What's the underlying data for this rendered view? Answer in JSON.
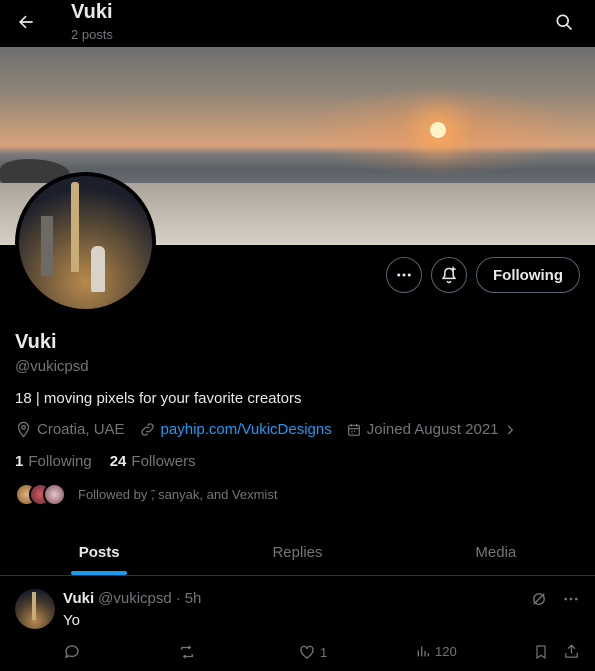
{
  "header": {
    "title": "Vuki",
    "subtitle": "2 posts"
  },
  "profile": {
    "name": "Vuki",
    "handle": "@vukicpsd",
    "bio": "18 | moving pixels for your favorite creators",
    "location": "Croatia, UAE",
    "website": "payhip.com/VukicDesigns",
    "joined": "Joined August 2021",
    "following_count": "1",
    "following_label": "Following",
    "followers_count": "24",
    "followers_label": "Followers",
    "followed_by": "Followed by ̃, sanyak, and Vexmist",
    "follow_button_label": "Following"
  },
  "tabs": [
    {
      "label": "Posts",
      "active": true
    },
    {
      "label": "Replies",
      "active": false
    },
    {
      "label": "Media",
      "active": false
    }
  ],
  "post": {
    "author": "Vuki",
    "handle": "@vukicpsd",
    "separator": "·",
    "time": "5h",
    "text": "Yo",
    "likes": "1",
    "views": "120"
  },
  "colors": {
    "accent": "#1d9bf0",
    "background": "#000000",
    "muted": "#71767b",
    "border": "#2f3336"
  },
  "icons": [
    "back-arrow-icon",
    "search-icon",
    "more-icon",
    "notification-add-icon",
    "location-icon",
    "link-icon",
    "calendar-icon",
    "chevron-right-icon",
    "grok-icon",
    "reply-icon",
    "repost-icon",
    "like-icon",
    "views-icon",
    "bookmark-icon",
    "share-icon"
  ]
}
